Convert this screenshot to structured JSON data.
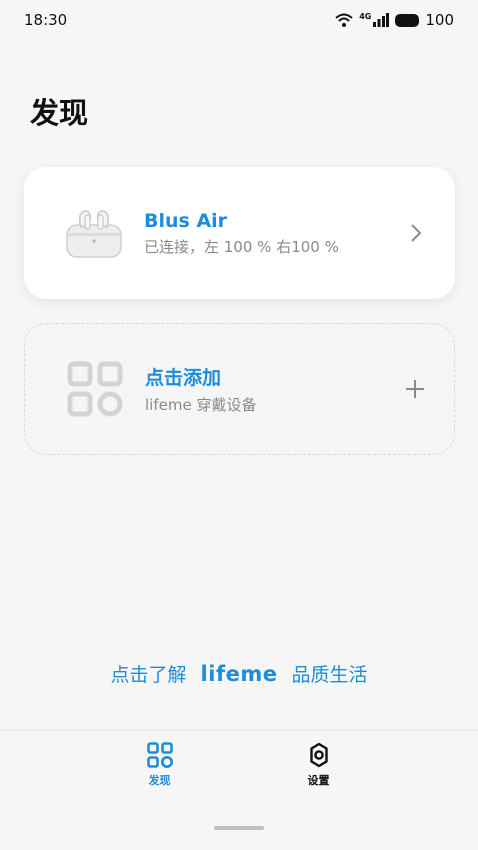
{
  "status_bar": {
    "time": "18:30",
    "network": "4G",
    "battery": "100",
    "icons": [
      "wifi-icon",
      "signal-icon",
      "battery-icon"
    ]
  },
  "page_title": "发现",
  "device_card": {
    "name": "Blus Air",
    "status": "已连接，左 100 % 右100 %",
    "icon": "earbuds-case-icon",
    "action_icon": "chevron-right-icon"
  },
  "add_card": {
    "title": "点击添加",
    "subtitle": "lifeme 穿戴设备",
    "icon": "grid-apps-icon",
    "action_icon": "plus-icon"
  },
  "promo": {
    "prefix": "点击了解",
    "brand": "lifeme",
    "suffix": "品质生活"
  },
  "bottom_nav": [
    {
      "label": "发现",
      "icon": "grid-apps-icon",
      "active": true
    },
    {
      "label": "设置",
      "icon": "gear-icon",
      "active": false
    }
  ],
  "colors": {
    "accent": "#1c8ddb",
    "background": "#f6f6f6",
    "card": "#ffffff",
    "secondary_text": "#8a8a8a"
  }
}
